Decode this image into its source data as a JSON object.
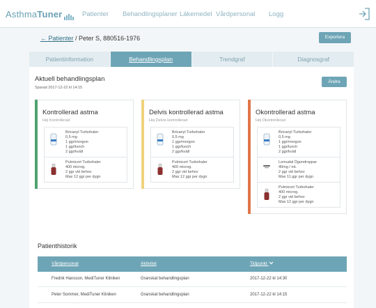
{
  "nav": {
    "logo_a": "Asthma",
    "logo_b": "Tuner",
    "items": [
      "Patienter",
      "Behandlingsplaner",
      "Läkemedel",
      "Vårdpersonal",
      "Logg"
    ]
  },
  "breadcrumb": {
    "link": "← Patienter",
    "separator": " / ",
    "current": "Peter S, 880516-1976"
  },
  "export_label": "Exportera",
  "tabs": [
    "Patientinformation",
    "Behandlingsplan",
    "Trendgraf",
    "Diagnosgraf"
  ],
  "plan": {
    "title": "Aktuell behandlingsplan",
    "saved": "Sparad 2017-12-22 kl 14:15",
    "edit_label": "Ändra"
  },
  "levels": [
    {
      "title": "Kontrollerad astma",
      "subtitle": "Hej Kontrollerad",
      "color": "#4fa36f",
      "meds": [
        {
          "icon": "inhaler-icon",
          "lines": [
            "Bricanyl Turbohaler",
            "0,5 mg",
            "1 ggr/morgon",
            "1 ggr/lunch",
            "2 ggr/kväll"
          ]
        },
        {
          "icon": "turbohaler-icon",
          "lines": [
            "Pulmicort Turbohaler",
            "400 microg.",
            "2 ggr vid behov",
            "Max 12 ggr per dygn"
          ]
        }
      ]
    },
    {
      "title": "Delvis kontrollerad astma",
      "subtitle": "Hej Delvis kontrollerad",
      "color": "#f0d27c",
      "meds": [
        {
          "icon": "inhaler-icon",
          "lines": [
            "Bricanyl Turbohaler",
            "0,5 mg",
            "1 ggr/morgon",
            "1 ggr/lunch",
            "2 ggr/kväll"
          ]
        },
        {
          "icon": "turbohaler-icon",
          "lines": [
            "Pulmicort Turbohaler",
            "400 microg.",
            "2 ggr vid behov",
            "Max 12 ggr per dygn"
          ]
        }
      ]
    },
    {
      "title": "Okontrollerad astma",
      "subtitle": "Hej Okontrollerad",
      "color": "#e0764a",
      "meds": [
        {
          "icon": "inhaler-icon",
          "lines": [
            "Bricanyl Turbohaler",
            "0,5 mg",
            "1 ggr/morgon",
            "1 ggr/lunch",
            "2 ggr/kväll"
          ]
        },
        {
          "icon": "eyedrop-icon",
          "lines": [
            "Lomudal Ögondroppar",
            "40mg / mL",
            "2 ggr vid behov",
            "Max 11 ggr per dygn"
          ]
        },
        {
          "icon": "turbohaler-icon",
          "lines": [
            "Pulmicort Turbohaler",
            "400 microg.",
            "2 ggr vid behov",
            "Max 12 ggr per dygn"
          ]
        }
      ]
    }
  ],
  "history": {
    "title": "Patienthistorik",
    "headers": [
      "Vårdpersonal",
      "Aktivitet",
      "Tidpunkt"
    ],
    "rows": [
      [
        "Fredrik Hansson, MediTuner Kliniken",
        "Granskat behandlingsplan",
        "2017-12-22 kl 14:30"
      ],
      [
        "Peter Sommer, MediTuner Kliniken",
        "Granskat behandlingsplan",
        "2017-12-22 kl 14:15"
      ]
    ]
  }
}
